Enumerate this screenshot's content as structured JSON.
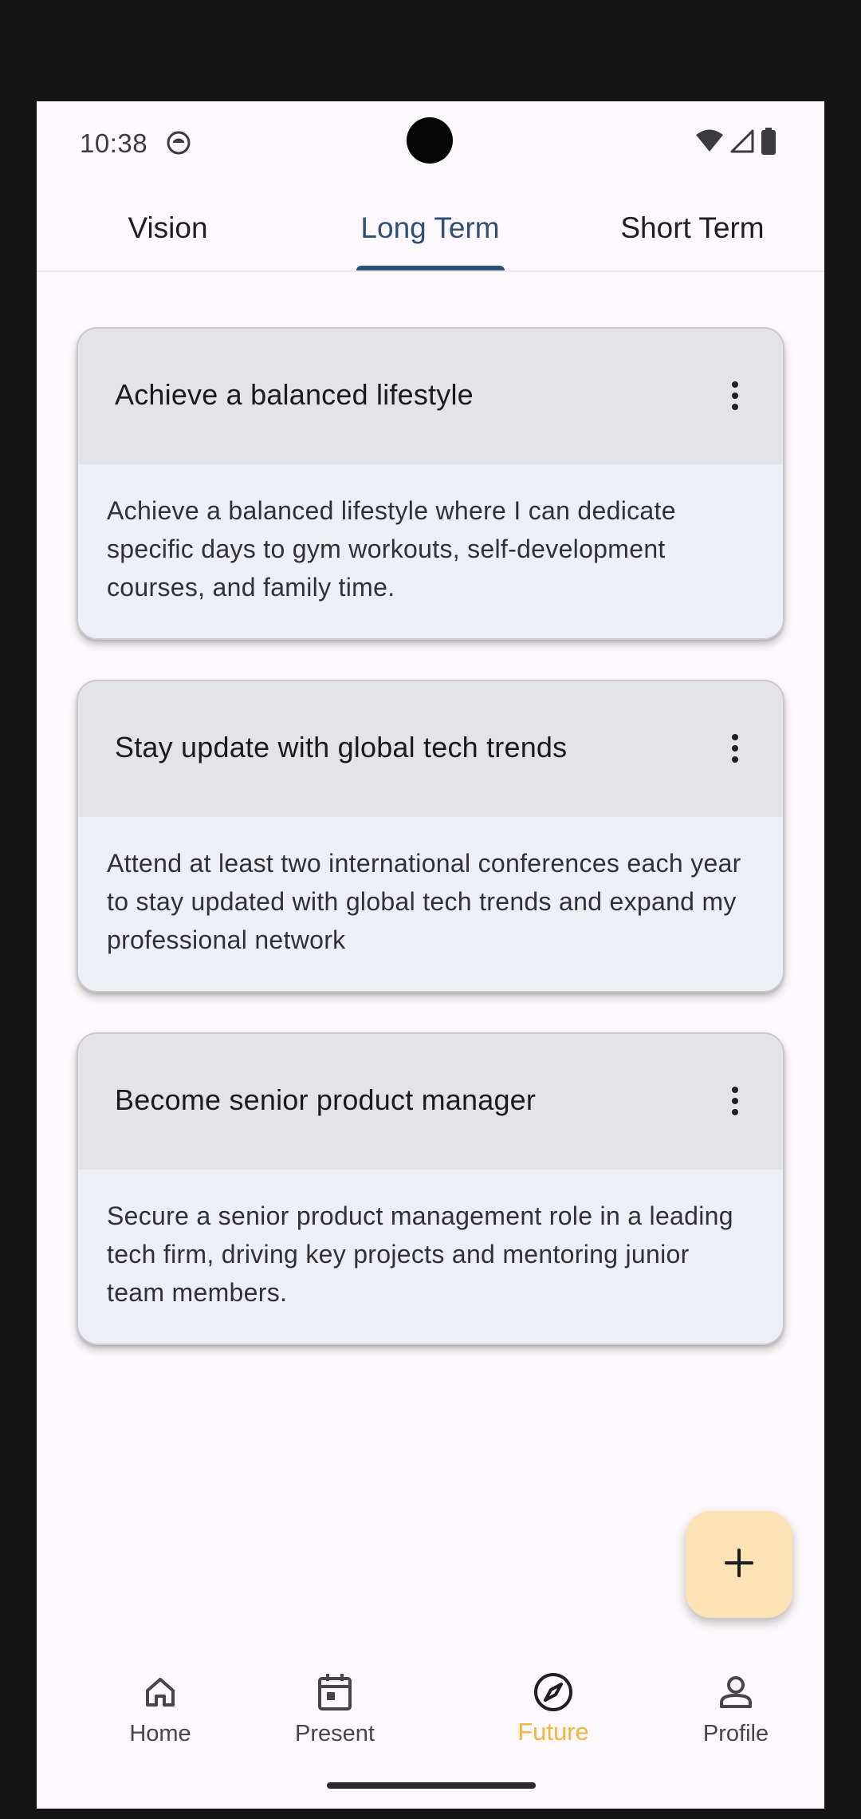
{
  "status_bar": {
    "time": "10:38"
  },
  "tabs": [
    {
      "label": "Vision",
      "active": false
    },
    {
      "label": "Long Term",
      "active": true
    },
    {
      "label": "Short Term",
      "active": false
    }
  ],
  "goals": [
    {
      "title": "Achieve a balanced lifestyle",
      "description": "Achieve a balanced lifestyle where I can dedicate specific days to gym workouts, self-development courses, and family time."
    },
    {
      "title": "Stay update with global tech trends",
      "description": "Attend at least two international conferences each year to stay updated with global tech trends and expand my professional network"
    },
    {
      "title": "Become senior product manager",
      "description": "Secure a senior product management role in a leading tech firm, driving key projects and mentoring junior team members."
    }
  ],
  "fab": {
    "icon": "plus-icon"
  },
  "bottom_nav": [
    {
      "label": "Home",
      "icon": "home-icon",
      "active": false
    },
    {
      "label": "Present",
      "icon": "calendar-icon",
      "active": false
    },
    {
      "label": "Future",
      "icon": "compass-icon",
      "active": true
    },
    {
      "label": "Profile",
      "icon": "person-icon",
      "active": false
    }
  ],
  "colors": {
    "accent": "#2f4f79",
    "nav_active": "#f2b63f",
    "fab": "#fde2b5"
  }
}
